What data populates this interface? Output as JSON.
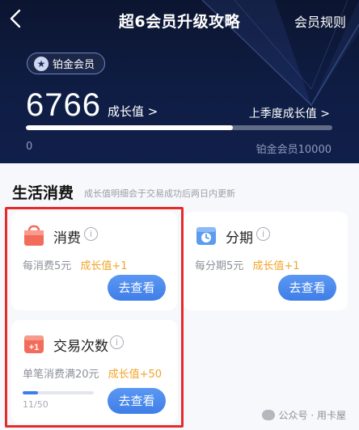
{
  "nav": {
    "back_icon": "chevron-left-icon",
    "title": "超6会员升级攻略",
    "rules": "会员规则"
  },
  "member": {
    "badge_icon": "star-icon",
    "badge_label": "铂金会员",
    "growth_value": "6766",
    "growth_link": "成长值 >",
    "last_season_link": "上季度成长值 >",
    "progress_fraction": 0.6766,
    "range_start": "0",
    "range_end": "铂金会员10000"
  },
  "section": {
    "title": "生活消费",
    "note": "成长值明细会于交易成功后两日内更新"
  },
  "cards": [
    {
      "icon": "shopping-bag-icon",
      "title": "消费",
      "rule_prefix": "每消费5元",
      "rule_highlight": "成长值+1",
      "button": "去查看"
    },
    {
      "icon": "clock-calendar-icon",
      "title": "分期",
      "rule_prefix": "每分期5元",
      "rule_highlight": "成长值+1",
      "button": "去查看"
    },
    {
      "icon": "plus-one-icon",
      "title": "交易次数",
      "rule_prefix": "单笔消费满20元",
      "rule_highlight": "成长值+50",
      "button": "去查看",
      "progress_count": "11/50",
      "progress_fraction": 0.22
    }
  ],
  "watermark": "公众号 · 用卡屋",
  "colors": {
    "header_bg": "#0f1d44",
    "accent_blue": "#3f7ee8",
    "highlight_orange": "#f2a427",
    "annotation_red": "#e62b2b"
  }
}
